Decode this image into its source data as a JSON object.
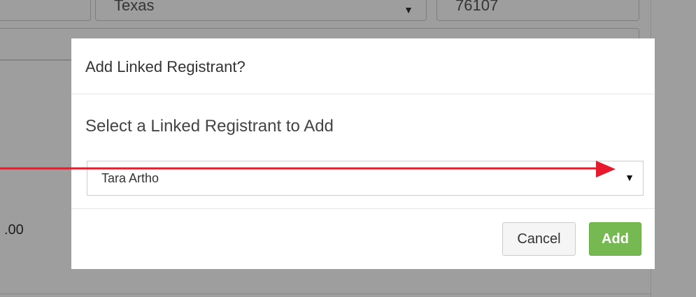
{
  "background": {
    "state_value": "Texas",
    "zip_value": "76107",
    "amount_fragment": ".00"
  },
  "modal": {
    "title": "Add Linked Registrant?",
    "prompt": "Select a Linked Registrant to Add",
    "select": {
      "selected_value": "Tara Artho",
      "caret_glyph": "▼"
    },
    "buttons": {
      "cancel_label": "Cancel",
      "add_label": "Add"
    }
  },
  "colors": {
    "primary_button": "#76b852",
    "annotation_arrow": "#e8192c",
    "overlay": "rgba(0,0,0,0.38)"
  },
  "icons": {
    "select_caret": "chevron-down-icon",
    "annotation": "red-arrow-annotation"
  }
}
